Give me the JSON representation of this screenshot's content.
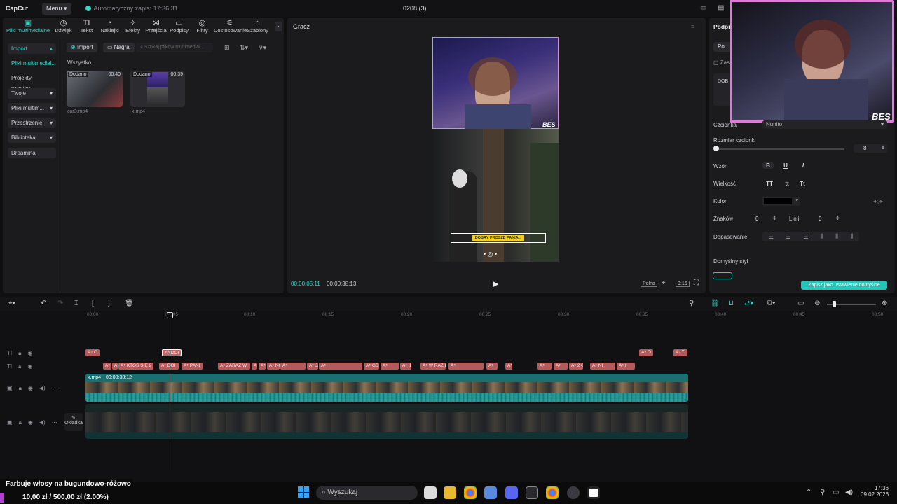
{
  "app": {
    "logo": "CapCut",
    "menu_label": "Menu",
    "autosave": "Automatyczny zapis: 17:36:31",
    "project_title": "0208 (3)"
  },
  "toolbar": {
    "tabs": [
      {
        "label": "Pliki multimedialne",
        "icon": "media-icon"
      },
      {
        "label": "Dźwięk",
        "icon": "audio-icon"
      },
      {
        "label": "Tekst",
        "icon": "text-icon"
      },
      {
        "label": "Naklejki",
        "icon": "sticker-icon"
      },
      {
        "label": "Efekty",
        "icon": "effects-icon"
      },
      {
        "label": "Przejścia",
        "icon": "transitions-icon"
      },
      {
        "label": "Podpisy",
        "icon": "captions-icon"
      },
      {
        "label": "Filtry",
        "icon": "filters-icon"
      },
      {
        "label": "Dostosowanie",
        "icon": "adjust-icon"
      },
      {
        "label": "Szablony",
        "icon": "templates-icon"
      }
    ]
  },
  "sidebar": {
    "items": [
      {
        "label": "Import"
      },
      {
        "label": "Pliki multimedial..."
      },
      {
        "label": "Projekty cząstko..."
      },
      {
        "label": "Twoje"
      },
      {
        "label": "Pliki multim..."
      },
      {
        "label": "Przestrzenie"
      },
      {
        "label": "Biblioteka"
      },
      {
        "label": "Dreamina"
      }
    ]
  },
  "media": {
    "import_label": "Import",
    "record_label": "Nagraj",
    "search_placeholder": "Szukaj plików multimedial...",
    "section_label": "Wszystko",
    "clips": [
      {
        "badge": "Dodano",
        "duration": "00:40",
        "name": "car3.mp4"
      },
      {
        "badge": "Dodano",
        "duration": "00:39",
        "name": "x.mp4"
      }
    ]
  },
  "player": {
    "title": "Gracz",
    "caption": "DOBRY PROSZĘ PANIĄ...",
    "current_time": "00:00:05:11",
    "total_time": "00:00:38:13",
    "full_label": "Pełna",
    "ratio_label": "9:16",
    "overlay_text": "BES"
  },
  "inspector": {
    "title": "Podpis",
    "tab_short": "Po",
    "checkbox_label": "Zas",
    "text_preview": "DOB",
    "font_label": "Czcionka",
    "font_value": "Nunito",
    "size_label": "Rozmiar czcionki",
    "size_value": "8",
    "pattern_label": "Wzór",
    "case_label": "Wielkość",
    "case_options": [
      "TT",
      "tt",
      "Tt"
    ],
    "color_label": "Kolor",
    "color_value": "#000000",
    "spacing_label": "Znaków",
    "spacing_value": "0",
    "lines_label": "Linii",
    "lines_value": "0",
    "align_label": "Dopasowanie",
    "default_style_label": "Domyślny styl",
    "save_default_label": "Zapisz jako ustawienie domyślne"
  },
  "timeline": {
    "ruler": [
      "00:00",
      "|00:05",
      "00:10",
      "00:15",
      "00:20",
      "00:25",
      "00:30",
      "00:35",
      "00:40",
      "00:45",
      "00:50"
    ],
    "main_clip_name": "x.mp4",
    "main_clip_duration": "00:00:38:12",
    "cover_label": "Okładka",
    "text_track1": [
      "O",
      "DOI",
      "O",
      "TI"
    ],
    "text_track2": [
      "",
      "",
      "KTOŚ SIĘ 2",
      "DOI",
      "PANI",
      "ZARAZ W",
      "",
      "B",
      "NO TO",
      "",
      "JADĘ NA SPOT",
      "",
      "GD",
      "",
      "IDĘ S",
      "W RAZIE C",
      "",
      "",
      "",
      "",
      "",
      "2 6 9 0",
      "NI",
      "I"
    ]
  },
  "taskbar": {
    "notification_title": "Farbuje włosy na bugundowo-różowo",
    "notification_value": "10,00 zł  /  500,00 zł (2.00%)",
    "search_placeholder": "Wyszukaj",
    "time": "17:36",
    "date": "09.02.2026"
  },
  "colors": {
    "accent": "#34d4c4",
    "text_chip": "#b55a5a",
    "video_track": "#1d8a88"
  }
}
